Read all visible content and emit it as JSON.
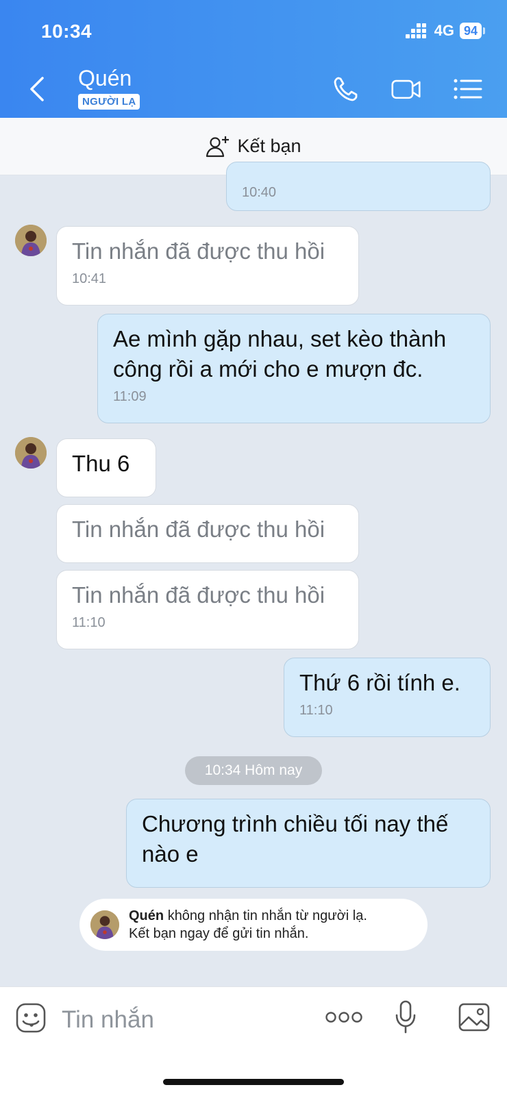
{
  "status_bar": {
    "time": "10:34",
    "network": "4G",
    "battery": "94"
  },
  "header": {
    "title": "Quén",
    "badge": "NGƯỜI LẠ"
  },
  "add_friend": {
    "label": "Kết bạn"
  },
  "messages": [
    {
      "dir": "out",
      "text": "",
      "time": "10:40"
    },
    {
      "dir": "in",
      "text": "Tin nhắn đã được thu hồi",
      "time": "10:41",
      "recalled": true
    },
    {
      "dir": "out",
      "text": "Ae mình gặp nhau, set kèo thành công rồi a mới cho e mượn đc.",
      "time": "11:09"
    },
    {
      "dir": "in",
      "text": "Thu 6",
      "time": ""
    },
    {
      "dir": "in",
      "text": "Tin nhắn đã được thu hồi",
      "time": "",
      "recalled": true
    },
    {
      "dir": "in",
      "text": "Tin nhắn đã được thu hồi",
      "time": "11:10",
      "recalled": true
    },
    {
      "dir": "out",
      "text": "Thứ 6 rồi tính e.",
      "time": "11:10"
    },
    {
      "dir": "out",
      "text": "Chương trình chiều tối nay thế nào e",
      "time": ""
    }
  ],
  "day_separator": "10:34 Hôm nay",
  "notice": {
    "name": "Quén",
    "line1": "không nhận tin nhắn từ người lạ.",
    "line2": "Kết bạn ngay để gửi tin nhắn."
  },
  "input": {
    "placeholder": "Tin nhắn"
  },
  "colors": {
    "header": "#3a86f0",
    "out_bubble": "#d5ebfb",
    "in_bubble": "#ffffff",
    "chat_bg": "#e2e8f0"
  }
}
